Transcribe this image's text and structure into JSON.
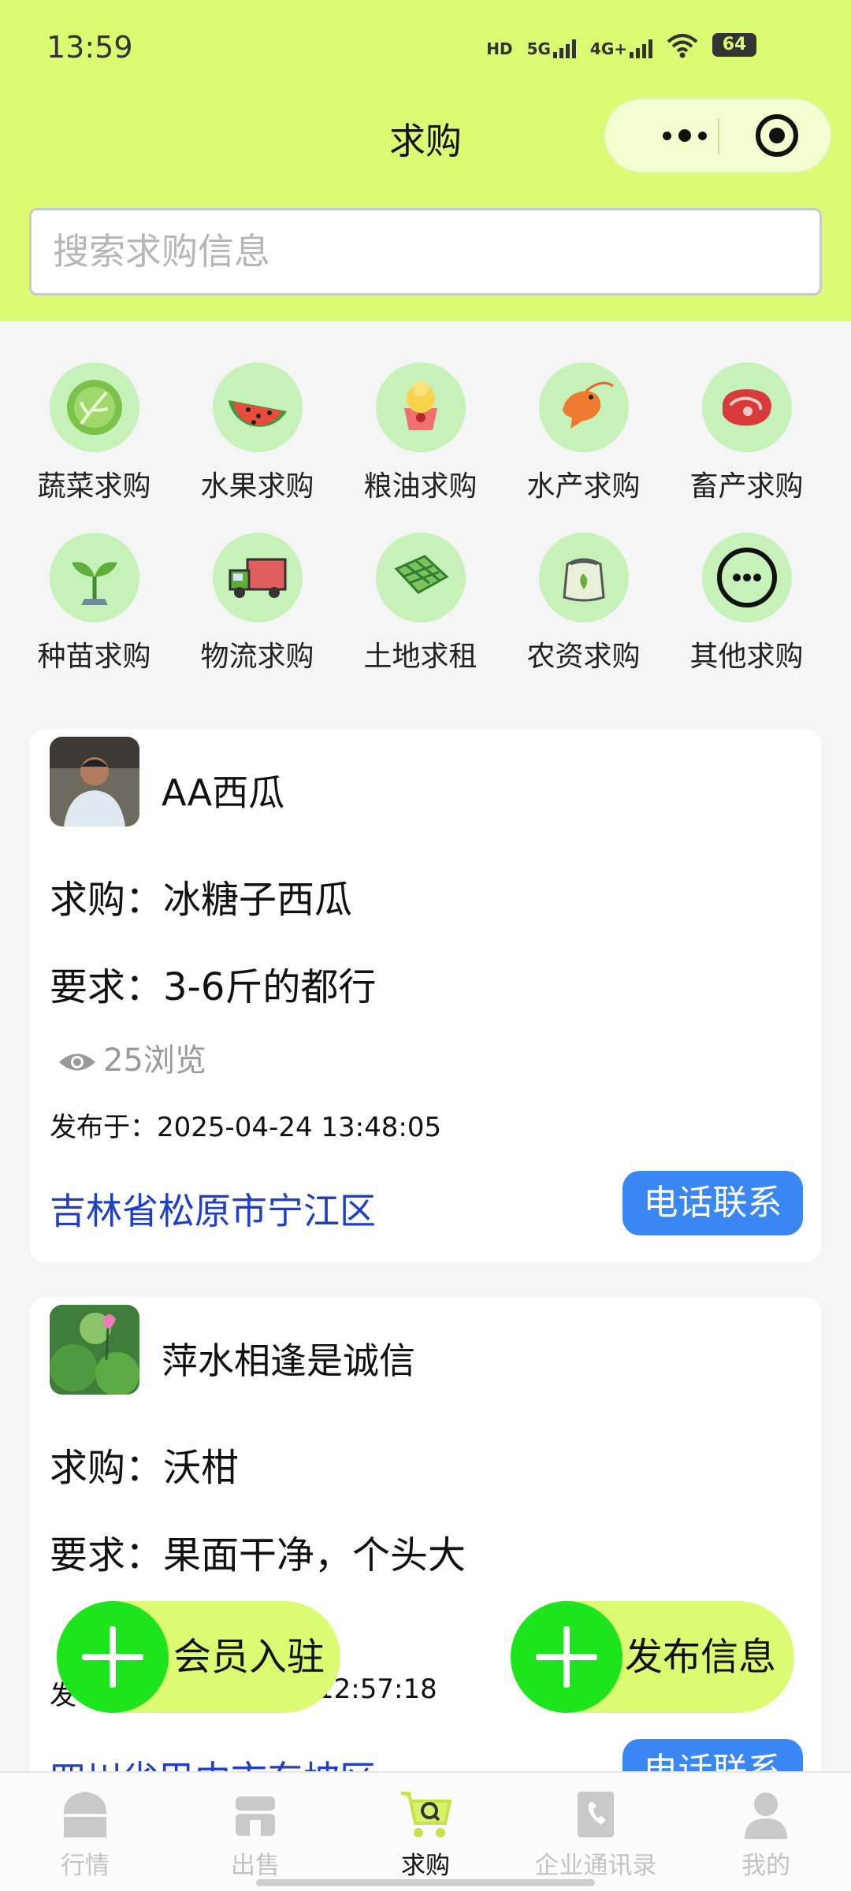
{
  "status_bar": {
    "time": "13:59",
    "network_1": "HD",
    "network_2": "5G",
    "network_3": "4G+",
    "battery": "64"
  },
  "nav": {
    "title": "求购"
  },
  "search": {
    "placeholder": "搜索求购信息"
  },
  "categories": [
    {
      "label": "蔬菜求购",
      "icon": "cabbage-icon"
    },
    {
      "label": "水果求购",
      "icon": "watermelon-icon"
    },
    {
      "label": "粮油求购",
      "icon": "grain-oil-icon"
    },
    {
      "label": "水产求购",
      "icon": "shrimp-icon"
    },
    {
      "label": "畜产求购",
      "icon": "meat-icon"
    },
    {
      "label": "种苗求购",
      "icon": "seedling-icon"
    },
    {
      "label": "物流求购",
      "icon": "truck-icon"
    },
    {
      "label": "土地求租",
      "icon": "land-icon"
    },
    {
      "label": "农资求购",
      "icon": "fertilizer-sack-icon"
    },
    {
      "label": "其他求购",
      "icon": "more-icon"
    }
  ],
  "listings": [
    {
      "user": "AA西瓜",
      "want": "求购：冰糖子西瓜",
      "requirement": "要求：3-6斤的都行",
      "views": "25浏览",
      "published": "发布于：2025-04-24 13:48:05",
      "address": "吉林省松原市宁江区",
      "contact": "电话联系"
    },
    {
      "user": "萍水相逢是诚信",
      "want": "求购：沃柑",
      "requirement": "要求：果面干净，个头大",
      "published_prefix": "发",
      "published_suffix": "12:57:18",
      "address": "四川省巴中市东坡区",
      "contact": "电话联系"
    }
  ],
  "fabs": {
    "member": "会员入驻",
    "publish": "发布信息"
  },
  "tabs": [
    {
      "label": "行情",
      "icon": "market-icon"
    },
    {
      "label": "出售",
      "icon": "shop-icon"
    },
    {
      "label": "求购",
      "icon": "cart-search-icon",
      "active": true
    },
    {
      "label": "企业通讯录",
      "icon": "address-book-icon"
    },
    {
      "label": "我的",
      "icon": "profile-icon"
    }
  ],
  "colors": {
    "header": "#dbfb72",
    "fab_plus": "#1de51d",
    "contact_button": "#3a86f2",
    "address": "#1f3fc9"
  }
}
